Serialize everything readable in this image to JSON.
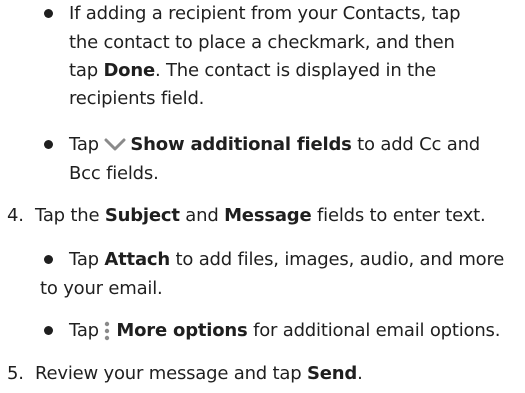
{
  "doc": {
    "bullet_contacts": {
      "line1": "If adding a recipient from your Contacts, tap",
      "line2": "the contact to place a checkmark, and then",
      "line3_pre": "tap ",
      "line3_bold": "Done",
      "line3_post": ". The contact is displayed in the",
      "line4": "recipients field."
    },
    "bullet_show_fields": {
      "pre": "Tap ",
      "bold": "Show additional fields",
      "post": " to add Cc and",
      "line2": "Bcc fields.",
      "icon": "chevron-down-icon"
    },
    "step4": {
      "num": "4.",
      "pre": "Tap the ",
      "bold1": "Subject",
      "mid": " and ",
      "bold2": "Message",
      "post": " fields to enter text."
    },
    "bullet_attach": {
      "pre": "Tap ",
      "bold": "Attach",
      "post": " to add files, images, audio, and more",
      "line2": "to your email."
    },
    "bullet_more": {
      "pre": "Tap ",
      "bold": "More options",
      "post": " for additional email options.",
      "icon": "more-options-icon"
    },
    "step5": {
      "num": "5.",
      "pre": "Review your message and tap ",
      "bold": "Send",
      "post": "."
    },
    "colors": {
      "text": "#1f1f1f",
      "icon": "#8a8a8a"
    }
  }
}
